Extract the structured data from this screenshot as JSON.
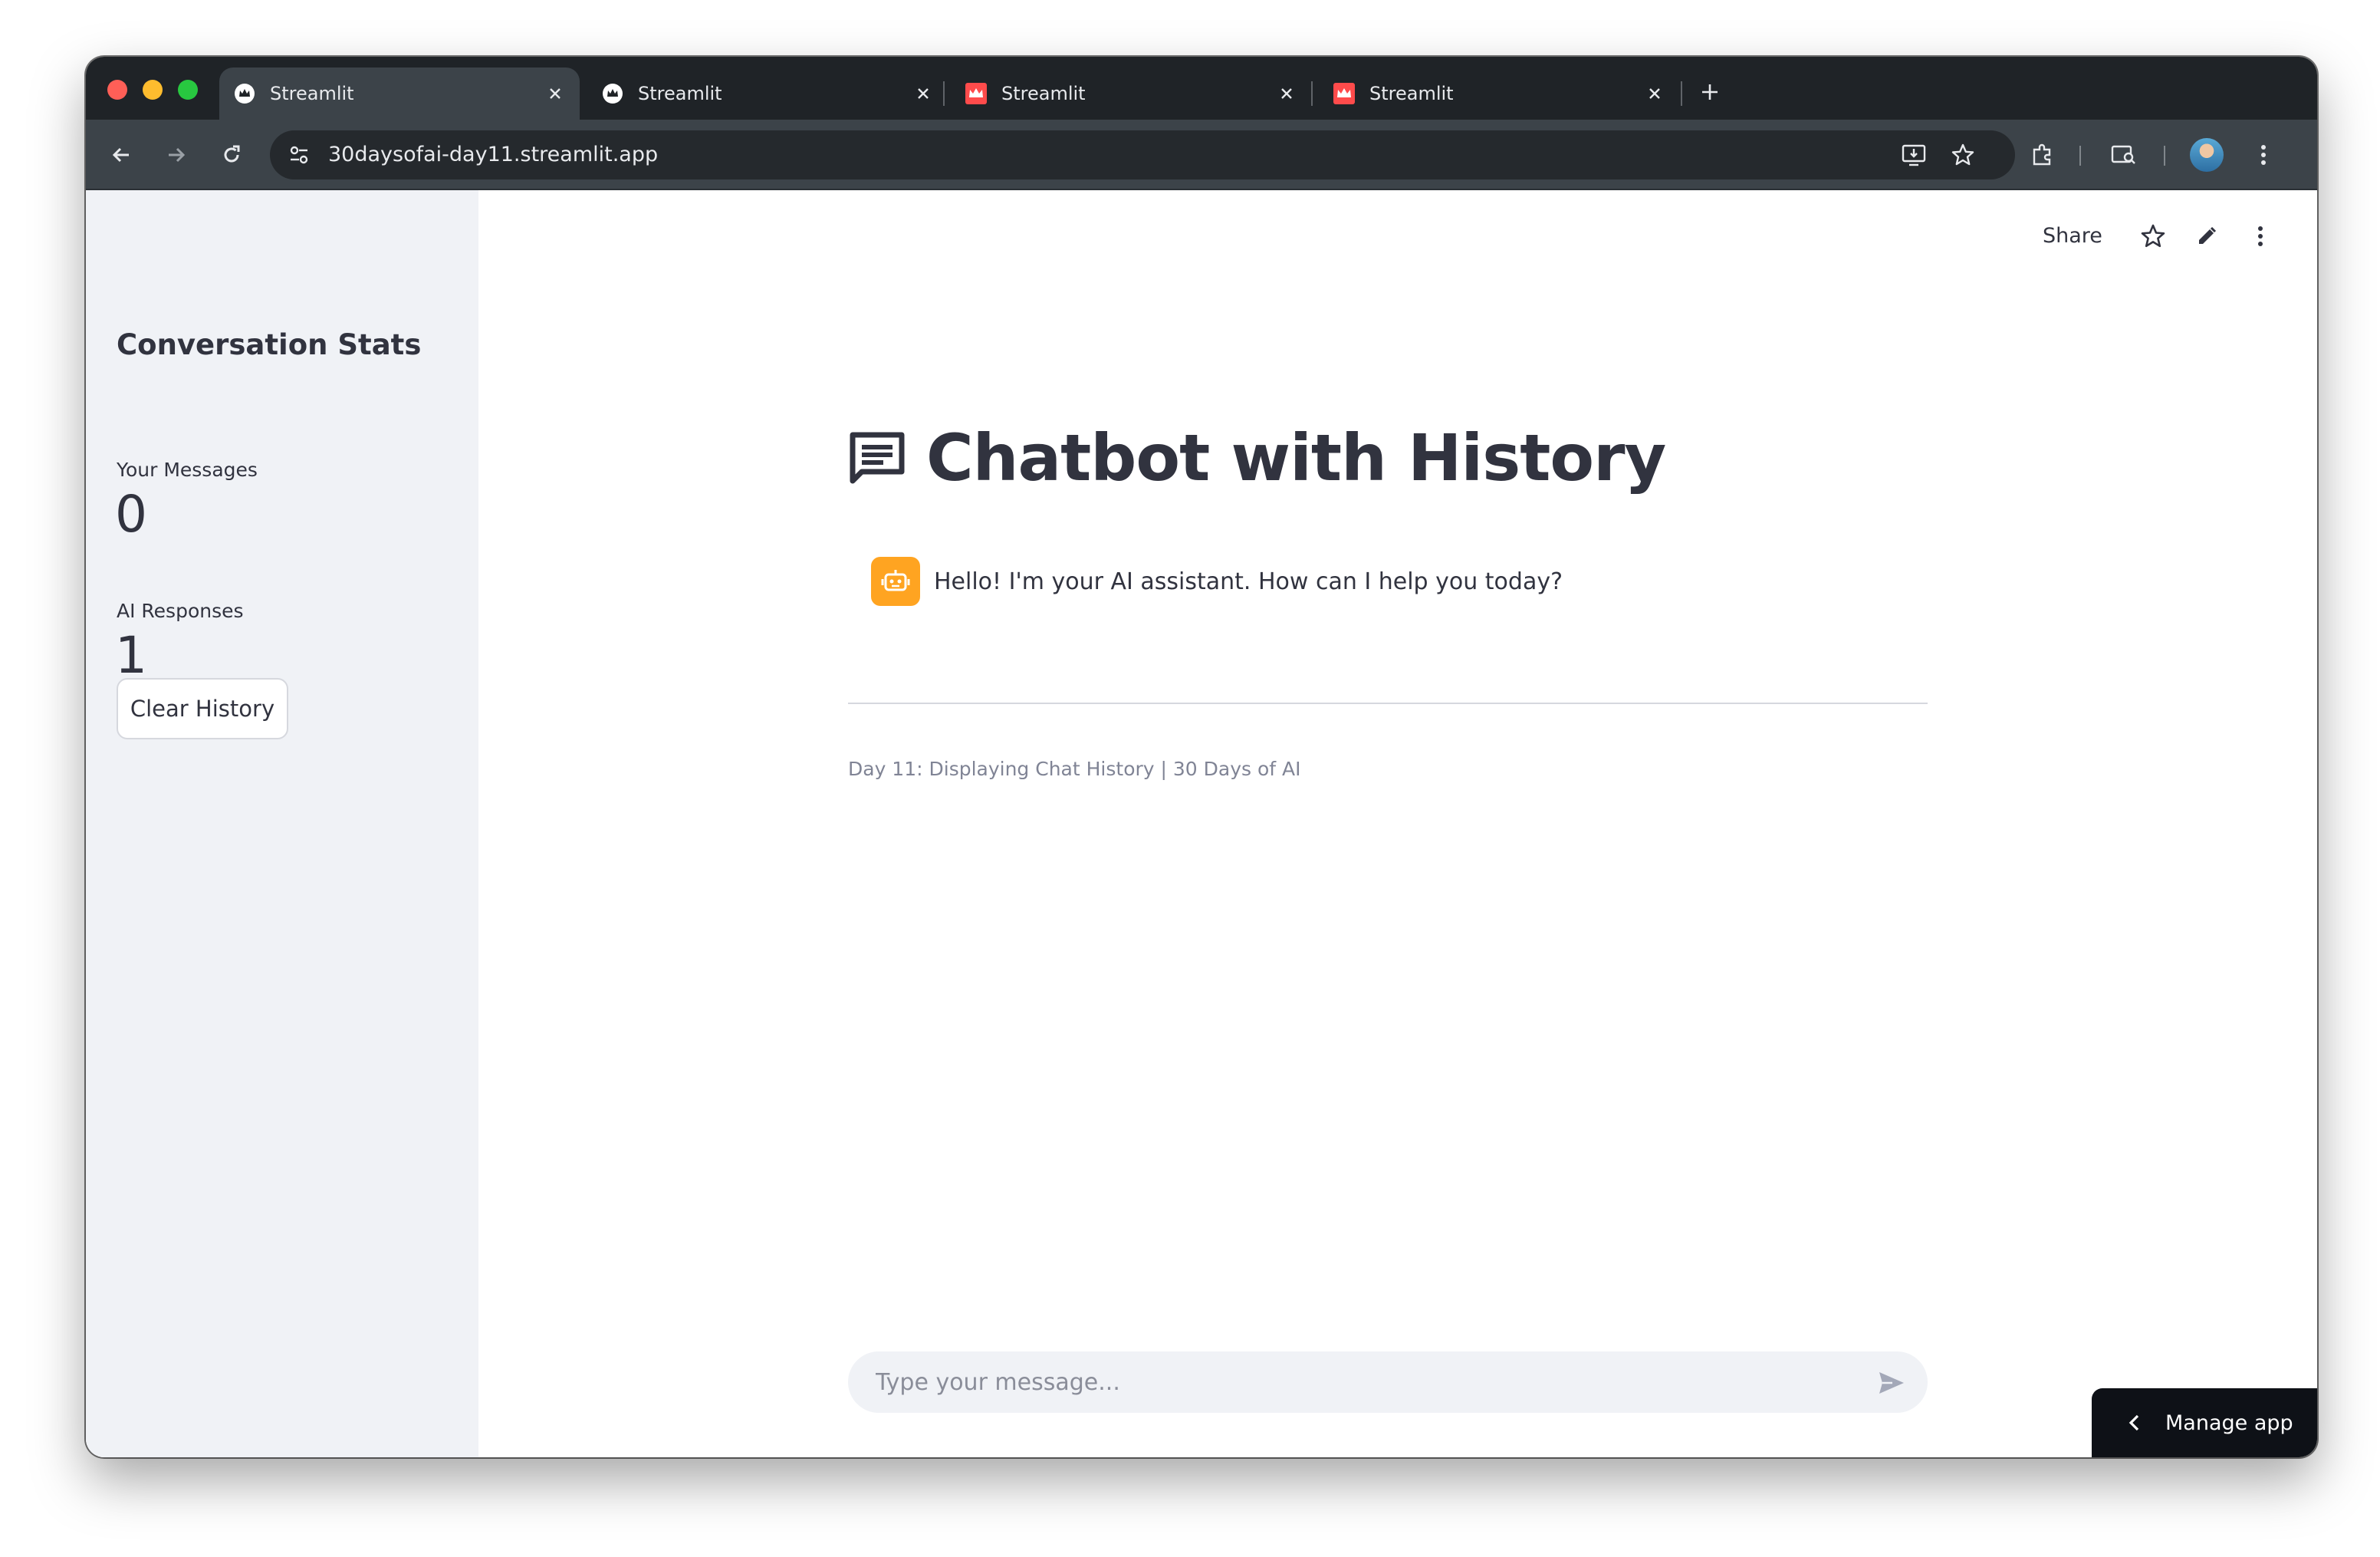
{
  "browser": {
    "tabs": [
      {
        "title": "Streamlit",
        "icon": "streamlit-crown-icon",
        "active": true
      },
      {
        "title": "Streamlit",
        "icon": "streamlit-crown-icon",
        "active": false
      },
      {
        "title": "Streamlit",
        "icon": "streamlit-red-icon",
        "active": false
      },
      {
        "title": "Streamlit",
        "icon": "streamlit-red-icon",
        "active": false
      }
    ],
    "url": "30daysofai-day11.streamlit.app"
  },
  "header": {
    "share_label": "Share"
  },
  "sidebar": {
    "title": "Conversation Stats",
    "metrics": [
      {
        "label": "Your Messages",
        "value": "0"
      },
      {
        "label": "AI Responses",
        "value": "1"
      }
    ],
    "clear_button_label": "Clear History"
  },
  "main": {
    "title": "Chatbot with History",
    "messages": [
      {
        "role": "assistant",
        "text": "Hello! I'm your AI assistant. How can I help you today?"
      }
    ],
    "caption": "Day 11: Displaying Chat History | 30 Days of AI",
    "chat_input_placeholder": "Type your message..."
  },
  "manage_app_label": "Manage app",
  "colors": {
    "sidebar_bg": "#f0f2f6",
    "text": "#31333f",
    "bot_avatar": "#ffa421",
    "streamlit_red": "#ff4b4b"
  }
}
